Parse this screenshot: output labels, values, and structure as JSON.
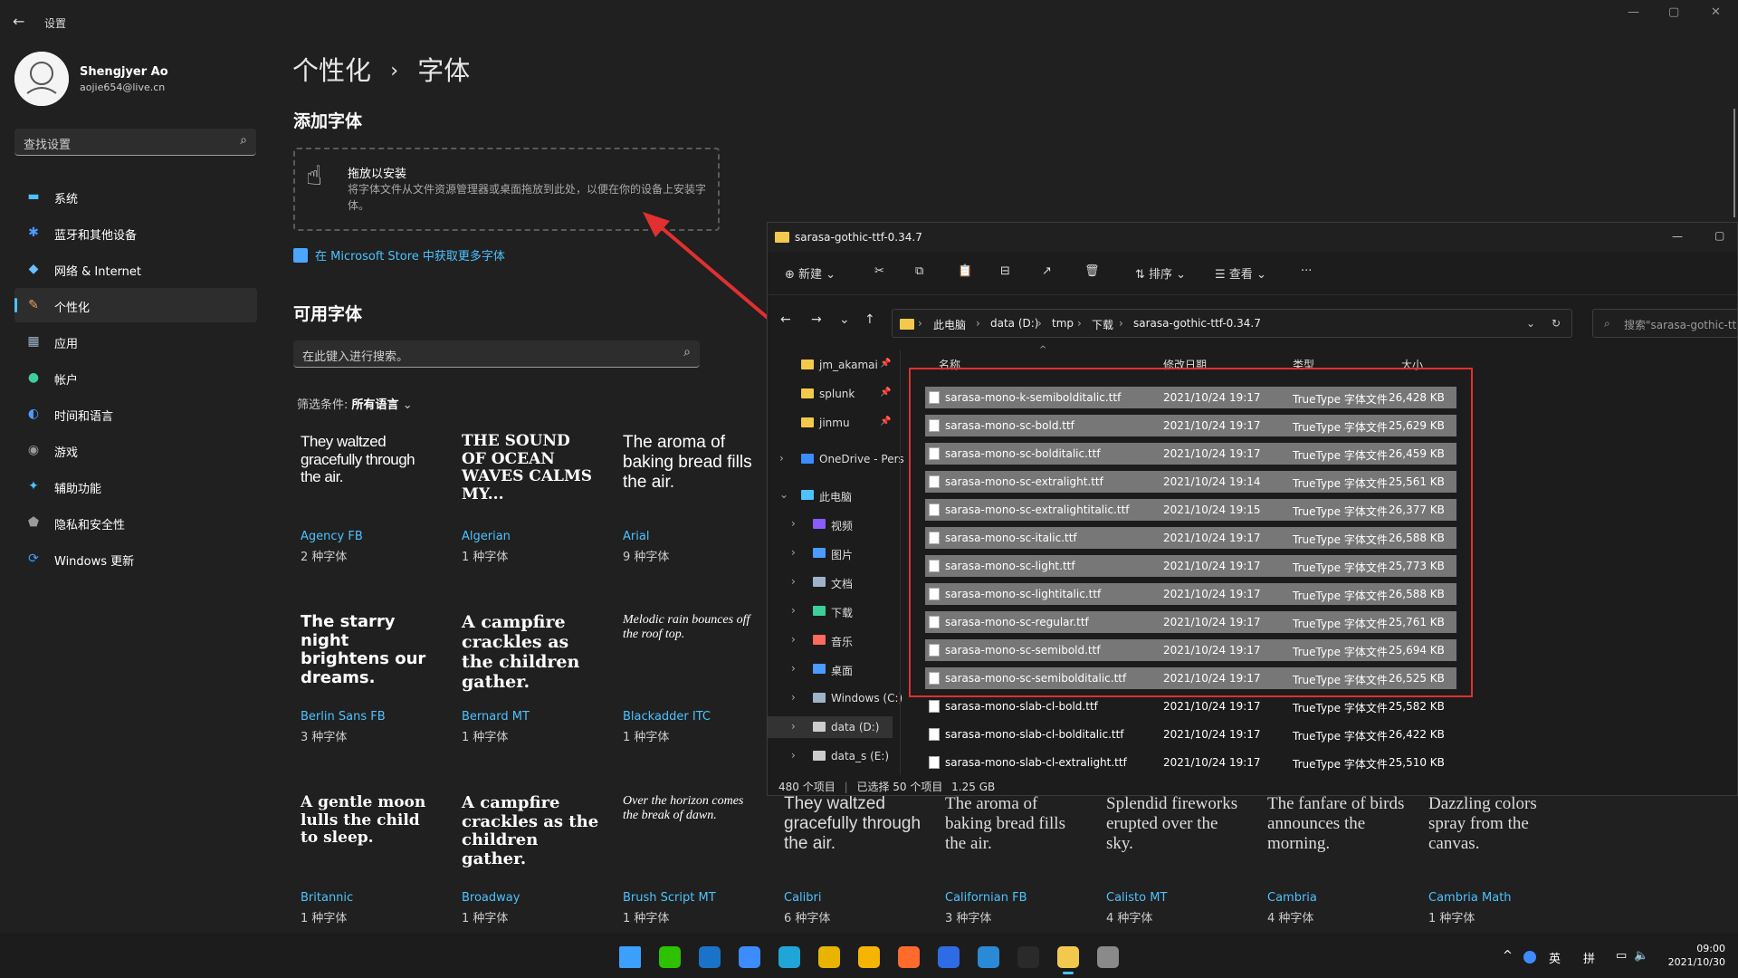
{
  "settings": {
    "app_title": "设置",
    "window_controls": [
      "—",
      "▢",
      "✕"
    ],
    "user": {
      "name": "Shengjyer Ao",
      "email": "aojie654@live.cn"
    },
    "search_placeholder": "查找设置",
    "nav": [
      {
        "label": "系统",
        "icon": "monitor-icon",
        "color": "#4cc2ff"
      },
      {
        "label": "蓝牙和其他设备",
        "icon": "bluetooth-icon",
        "color": "#4c9bff"
      },
      {
        "label": "网络 & Internet",
        "icon": "wifi-icon",
        "color": "#6cc0ff"
      },
      {
        "label": "个性化",
        "icon": "brush-icon",
        "color": "#e8a25a"
      },
      {
        "label": "应用",
        "icon": "apps-icon",
        "color": "#9fb3c8"
      },
      {
        "label": "帐户",
        "icon": "account-icon",
        "color": "#3ccf9a"
      },
      {
        "label": "时间和语言",
        "icon": "globe-clock-icon",
        "color": "#4c9bff"
      },
      {
        "label": "游戏",
        "icon": "gamepad-icon",
        "color": "#9a9a9a"
      },
      {
        "label": "辅助功能",
        "icon": "accessibility-icon",
        "color": "#4cc2ff"
      },
      {
        "label": "隐私和安全性",
        "icon": "shield-icon",
        "color": "#9a9a9a"
      },
      {
        "label": "Windows 更新",
        "icon": "update-icon",
        "color": "#3ca0ff"
      }
    ],
    "selected_nav": "个性化",
    "breadcrumb": {
      "parent": "个性化",
      "sep": "›",
      "current": "字体"
    },
    "add_fonts_title": "添加字体",
    "drop_title": "拖放以安装",
    "drop_desc": "将字体文件从文件资源管理器或桌面拖放到此处，以便在你的设备上安装字体。",
    "store_link": "在 Microsoft Store 中获取更多字体",
    "available_title": "可用字体",
    "font_search_placeholder": "在此键入进行搜索。",
    "filter_label": "筛选条件:",
    "filter_value": "所有语言",
    "fonts": [
      {
        "sample": "They waltzed gracefully through the air.",
        "name": "Agency FB",
        "count": "2 种字体"
      },
      {
        "sample": "THE SOUND OF OCEAN WAVES CALMS MY...",
        "name": "Algerian",
        "count": "1 种字体"
      },
      {
        "sample": "The aroma of baking bread fills the air.",
        "name": "Arial",
        "count": "9 种字体"
      },
      {
        "sample": "The starry night brightens our dreams.",
        "name": "Berlin Sans FB",
        "count": "3 种字体"
      },
      {
        "sample": "A campfire crackles as the children gather.",
        "name": "Bernard MT",
        "count": "1 种字体"
      },
      {
        "sample": "Melodic rain bounces off the roof top.",
        "name": "Blackadder ITC",
        "count": "1 种字体"
      },
      {
        "sample": "A gentle moon lulls the child to sleep.",
        "name": "Britannic",
        "count": "1 种字体"
      },
      {
        "sample": "A campfire crackles as the children gather.",
        "name": "Broadway",
        "count": "1 种字体"
      },
      {
        "sample": "Over the horizon comes the break of dawn.",
        "name": "Brush Script MT",
        "count": "1 种字体"
      },
      {
        "sample": "They waltzed gracefully through the air.",
        "name": "Calibri",
        "count": "6 种字体"
      },
      {
        "sample": "The aroma of baking bread fills the air.",
        "name": "Californian FB",
        "count": "3 种字体"
      },
      {
        "sample": "Splendid fireworks erupted over the sky.",
        "name": "Calisto MT",
        "count": "4 种字体"
      },
      {
        "sample": "The fanfare of birds announces the morning.",
        "name": "Cambria",
        "count": "4 种字体"
      },
      {
        "sample": "Dazzling colors spray from the canvas.",
        "name": "Cambria Math",
        "count": "1 种字体"
      }
    ]
  },
  "explorer": {
    "title": "sarasa-gothic-ttf-0.34.7",
    "toolbar": {
      "new": "新建",
      "sort": "排序",
      "view": "查看",
      "more": "···"
    },
    "path": [
      "此电脑",
      "data (D:)",
      "tmp",
      "下载",
      "sarasa-gothic-ttf-0.34.7"
    ],
    "search_placeholder": "搜索\"sarasa-gothic-tt",
    "tree": [
      {
        "label": "jm_akamai",
        "pin": true
      },
      {
        "label": "splunk",
        "pin": true
      },
      {
        "label": "jinmu",
        "pin": true
      },
      {
        "label": "OneDrive - Pers",
        "pin": false
      },
      {
        "label": "此电脑",
        "pin": false
      },
      {
        "label": "视频",
        "pin": false
      },
      {
        "label": "图片",
        "pin": false
      },
      {
        "label": "文档",
        "pin": false
      },
      {
        "label": "下载",
        "pin": false
      },
      {
        "label": "音乐",
        "pin": false
      },
      {
        "label": "桌面",
        "pin": false
      },
      {
        "label": "Windows (C:)",
        "pin": false
      },
      {
        "label": "data (D:)",
        "pin": false
      },
      {
        "label": "data_s (E:)",
        "pin": false
      }
    ],
    "columns": [
      "名称",
      "修改日期",
      "类型",
      "大小"
    ],
    "files": [
      {
        "name": "sarasa-mono-k-semibolditalic.ttf",
        "date": "2021/10/24 19:17",
        "type": "TrueType 字体文件",
        "size": "26,428 KB",
        "selected": true
      },
      {
        "name": "sarasa-mono-sc-bold.ttf",
        "date": "2021/10/24 19:17",
        "type": "TrueType 字体文件",
        "size": "25,629 KB",
        "selected": true
      },
      {
        "name": "sarasa-mono-sc-bolditalic.ttf",
        "date": "2021/10/24 19:17",
        "type": "TrueType 字体文件",
        "size": "26,459 KB",
        "selected": true
      },
      {
        "name": "sarasa-mono-sc-extralight.ttf",
        "date": "2021/10/24 19:14",
        "type": "TrueType 字体文件",
        "size": "25,561 KB",
        "selected": true
      },
      {
        "name": "sarasa-mono-sc-extralightitalic.ttf",
        "date": "2021/10/24 19:15",
        "type": "TrueType 字体文件",
        "size": "26,377 KB",
        "selected": true
      },
      {
        "name": "sarasa-mono-sc-italic.ttf",
        "date": "2021/10/24 19:17",
        "type": "TrueType 字体文件",
        "size": "26,588 KB",
        "selected": true
      },
      {
        "name": "sarasa-mono-sc-light.ttf",
        "date": "2021/10/24 19:17",
        "type": "TrueType 字体文件",
        "size": "25,773 KB",
        "selected": true
      },
      {
        "name": "sarasa-mono-sc-lightitalic.ttf",
        "date": "2021/10/24 19:17",
        "type": "TrueType 字体文件",
        "size": "26,588 KB",
        "selected": true
      },
      {
        "name": "sarasa-mono-sc-regular.ttf",
        "date": "2021/10/24 19:17",
        "type": "TrueType 字体文件",
        "size": "25,761 KB",
        "selected": true
      },
      {
        "name": "sarasa-mono-sc-semibold.ttf",
        "date": "2021/10/24 19:17",
        "type": "TrueType 字体文件",
        "size": "25,694 KB",
        "selected": true
      },
      {
        "name": "sarasa-mono-sc-semibolditalic.ttf",
        "date": "2021/10/24 19:17",
        "type": "TrueType 字体文件",
        "size": "26,525 KB",
        "selected": true
      },
      {
        "name": "sarasa-mono-slab-cl-bold.ttf",
        "date": "2021/10/24 19:17",
        "type": "TrueType 字体文件",
        "size": "25,582 KB",
        "selected": false
      },
      {
        "name": "sarasa-mono-slab-cl-bolditalic.ttf",
        "date": "2021/10/24 19:17",
        "type": "TrueType 字体文件",
        "size": "26,422 KB",
        "selected": false
      },
      {
        "name": "sarasa-mono-slab-cl-extralight.ttf",
        "date": "2021/10/24 19:17",
        "type": "TrueType 字体文件",
        "size": "25,510 KB",
        "selected": false
      }
    ],
    "status": {
      "count": "480 个项目",
      "selected": "已选择 50 个项目",
      "size": "1.25 GB"
    }
  },
  "taskbar": {
    "apps": [
      "windows-start-icon",
      "wechat-icon",
      "outlook-icon",
      "vivaldi-icon",
      "edge-icon",
      "chrome-icon",
      "yellow-app-icon",
      "firefox-icon",
      "todo-icon",
      "vscode-icon",
      "terminal-icon",
      "file-explorer-icon",
      "settings-icon"
    ],
    "tray": {
      "caret": "^",
      "lang": "英",
      "ime": "拼"
    },
    "time": "09:00",
    "date": "2021/10/30"
  },
  "colors": {
    "accent": "#4cc2ff",
    "annotation_red": "#e03030"
  }
}
